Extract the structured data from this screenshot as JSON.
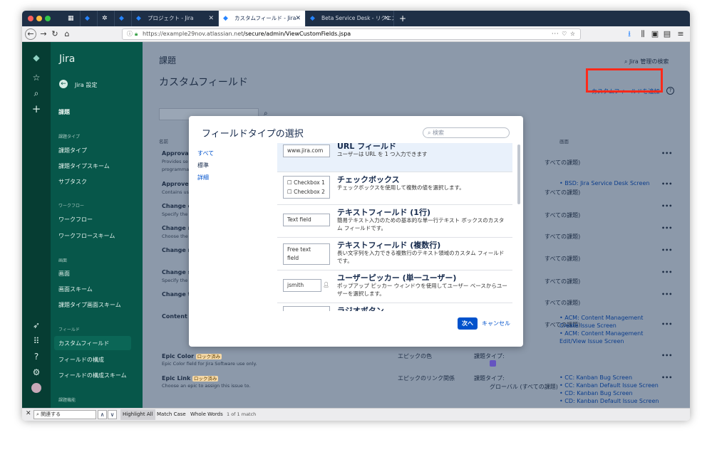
{
  "browser": {
    "tabs": [
      {
        "label": "",
        "icon": "calendar-icon"
      },
      {
        "label": "",
        "icon": "jira-icon"
      },
      {
        "label": "",
        "icon": "gear-icon"
      },
      {
        "label": "",
        "icon": "jira-icon"
      },
      {
        "label": "プロジェクト - Jira",
        "icon": "jira-icon"
      },
      {
        "label": "カスタムフィールド - Jira",
        "icon": "jira-icon"
      },
      {
        "label": "Beta Service Desk - リクエスト",
        "icon": "jira-icon"
      }
    ],
    "url_host": "https://example29nov.atlassian.net",
    "url_path": "/secure/admin/ViewCustomFields.jspa"
  },
  "sidebar": {
    "app_name": "Jira",
    "back_label": "Jira 設定",
    "section_main": "課題",
    "groups": [
      {
        "heading": "課題タイプ",
        "items": [
          "課題タイプ",
          "課題タイプスキーム",
          "サブタスク"
        ]
      },
      {
        "heading": "ワークフロー",
        "items": [
          "ワークフロー",
          "ワークフロースキーム"
        ]
      },
      {
        "heading": "画面",
        "items": [
          "画面",
          "画面スキーム",
          "課題タイプ画面スキーム"
        ]
      },
      {
        "heading": "フィールド",
        "items": [
          "カスタムフィールド",
          "フィールドの構成",
          "フィールドの構成スキーム"
        ]
      },
      {
        "heading": "課題機能",
        "items": []
      }
    ]
  },
  "main": {
    "breadcrumb": "課題",
    "title": "カスタムフィールド",
    "search_link": "Jira 管理の検索",
    "add_button": "カスタムフィールドを追加",
    "col_name": "名前",
    "col_screens": "画面",
    "rows": [
      {
        "name": "Approvals",
        "desc1": "Provides se",
        "desc2": "programmat",
        "context": "すべての課題)",
        "screens": []
      },
      {
        "name": "Approvers",
        "desc1": "Contains us",
        "desc2": "",
        "context": "すべての課題)",
        "screens": [
          "BSD: Jira Service Desk Screen"
        ]
      },
      {
        "name": "Change c",
        "desc1": "Specify the",
        "desc2": "",
        "context": "すべての課題)",
        "screens": []
      },
      {
        "name": "Change re",
        "desc1": "Choose the",
        "desc2": "",
        "context": "すべての課題)",
        "screens": []
      },
      {
        "name": "Change ri",
        "desc1": "",
        "desc2": "",
        "context": "すべての課題)",
        "screens": []
      },
      {
        "name": "Change st",
        "desc1": "Specify the",
        "desc2": "",
        "context": "すべての課題)",
        "screens": []
      },
      {
        "name": "Change ty",
        "desc1": "",
        "desc2": "",
        "context": "すべての課題)",
        "screens": []
      },
      {
        "name": "Content ty",
        "desc1": "",
        "desc2": "",
        "context": "すべての課題)",
        "screens": [
          "ACM: Content Management Create Issue Screen",
          "ACM: Content Management Edit/View Issue Screen"
        ]
      }
    ],
    "epic_color": {
      "name": "Epic Color",
      "lock": "ロック済み",
      "desc": "Epic Color field for Jira Software use only.",
      "type": "エピックの色",
      "context": "課題タイプ:"
    },
    "epic_link": {
      "name": "Epic Link",
      "lock": "ロック済み",
      "desc": "Choose an epic to assign this issue to.",
      "type": "エピックのリンク関係",
      "context": "課題タイプ:",
      "context2": "グローバル (すべての課題)",
      "screens": [
        "CC: Kanban Bug Screen",
        "CC: Kanban Default Issue Screen",
        "CD: Kanban Bug Screen",
        "CD: Kanban Default Issue Screen"
      ]
    }
  },
  "modal": {
    "title": "フィールドタイプの選択",
    "search_placeholder": "検索",
    "filters": [
      "すべて",
      "標準",
      "詳細"
    ],
    "items": [
      {
        "title": "URL フィールド",
        "desc": "ユーザーは URL を 1 つ入力できます",
        "preview": [
          "www.jira.com"
        ]
      },
      {
        "title": "チェックボックス",
        "desc": "チェックボックスを使用して複数の値を選択します。",
        "preview": [
          "Checkbox 1",
          "Checkbox 2"
        ]
      },
      {
        "title": "テキストフィールド (1行)",
        "desc": "簡易テキスト入力のための基本的な単一行テキスト ボックスのカスタム フィールドです。",
        "preview": [
          "Text field"
        ]
      },
      {
        "title": "テキストフィールド (複数行)",
        "desc": "長い文字列を入力できる複数行のテキスト領域のカスタム フィールドです。",
        "preview": [
          "Free text field"
        ]
      },
      {
        "title": "ユーザーピッカー (単一ユーザー)",
        "desc": "ポップアップ ピッカー ウィンドウを使用してユーザー ベースからユーザーを選択します。",
        "preview": [
          "jsmith"
        ]
      },
      {
        "title": "ラジオボタン",
        "desc": "",
        "preview": []
      }
    ],
    "next_button": "次へ",
    "cancel_button": "キャンセル"
  },
  "findbar": {
    "query": "関連する",
    "highlight_all": "Highlight All",
    "match_case": "Match Case",
    "whole_words": "Whole Words",
    "result": "1 of 1 match"
  }
}
